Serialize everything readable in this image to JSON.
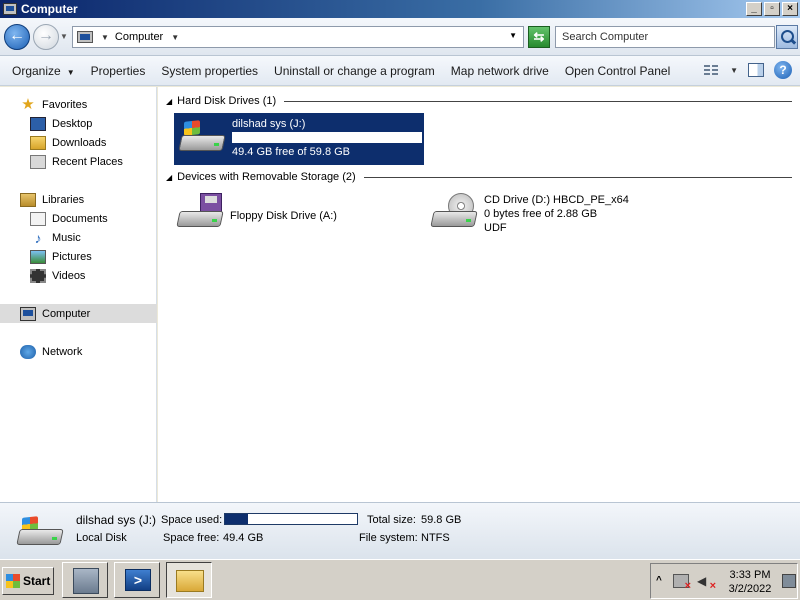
{
  "window": {
    "title": "Computer"
  },
  "address": {
    "location": "Computer",
    "search_placeholder": "Search Computer"
  },
  "commands": {
    "organize": "Organize",
    "properties": "Properties",
    "system_properties": "System properties",
    "uninstall": "Uninstall or change a program",
    "map_drive": "Map network drive",
    "control_panel": "Open Control Panel"
  },
  "nav": {
    "favorites": "Favorites",
    "desktop": "Desktop",
    "downloads": "Downloads",
    "recent": "Recent Places",
    "libraries": "Libraries",
    "documents": "Documents",
    "music": "Music",
    "pictures": "Pictures",
    "videos": "Videos",
    "computer": "Computer",
    "network": "Network"
  },
  "groups": {
    "hdd": "Hard Disk Drives (1)",
    "removable": "Devices with Removable Storage (2)"
  },
  "drives": {
    "j": {
      "name": "dilshad sys (J:)",
      "free": "49.4 GB free of 59.8 GB",
      "used_fraction": 0.174
    },
    "a": {
      "name": "Floppy Disk Drive (A:)"
    },
    "d": {
      "name": "CD Drive (D:) HBCD_PE_x64",
      "free": "0 bytes free of 2.88 GB",
      "fs": "UDF"
    }
  },
  "details": {
    "name": "dilshad sys (J:)",
    "type": "Local Disk",
    "space_used_label": "Space used:",
    "space_free_label": "Space free:",
    "space_free": "49.4 GB",
    "total_size_label": "Total size:",
    "total_size": "59.8 GB",
    "fs_label": "File system:",
    "fs": "NTFS",
    "used_fraction": 0.174
  },
  "taskbar": {
    "start": "Start",
    "time": "3:33 PM",
    "date": "3/2/2022"
  }
}
